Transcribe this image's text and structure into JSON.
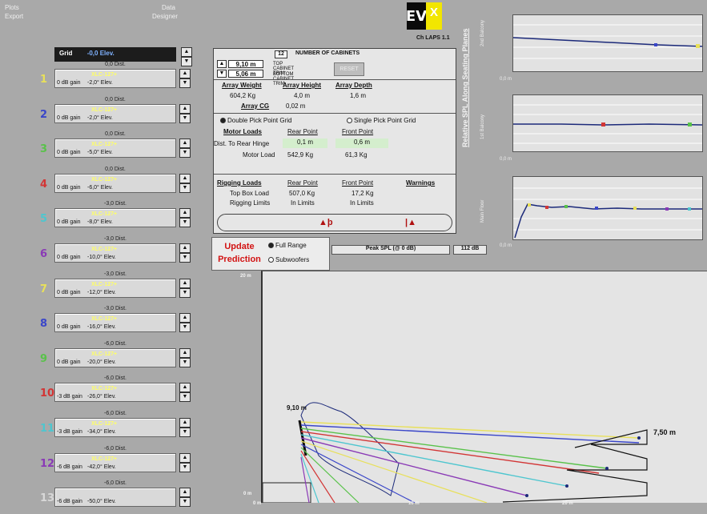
{
  "menu": {
    "left": [
      "Plots",
      "Export"
    ],
    "right": [
      "Data",
      "Designer"
    ]
  },
  "version": "Ch LAPS 1.1",
  "grid_row": {
    "label": "Grid",
    "value": "-0,0 Elev."
  },
  "cabinets": [
    {
      "num": "1",
      "num_color": "#e8e05a",
      "dist": "0,0 Dist.",
      "label": "XLC-127+",
      "gain": "0 dB gain",
      "elev": "-2,0° Elev."
    },
    {
      "num": "2",
      "num_color": "#3a46c9",
      "dist": "0,0 Dist.",
      "label": "XLC-127+",
      "gain": "0 dB gain",
      "elev": "-2,0° Elev."
    },
    {
      "num": "3",
      "num_color": "#59c24a",
      "dist": "0,0 Dist.",
      "label": "XLC-127+",
      "gain": "0 dB gain",
      "elev": "-5,0° Elev."
    },
    {
      "num": "4",
      "num_color": "#d23535",
      "dist": "0,0 Dist.",
      "label": "XLC-127+",
      "gain": "0 dB gain",
      "elev": "-6,0° Elev."
    },
    {
      "num": "5",
      "num_color": "#4ec6cf",
      "dist": "-3,0 Dist.",
      "label": "XLC-127+",
      "gain": "0 dB gain",
      "elev": "-8,0° Elev."
    },
    {
      "num": "6",
      "num_color": "#8a3ab6",
      "dist": "-3,0 Dist.",
      "label": "XLC-127+",
      "gain": "0 dB gain",
      "elev": "-10,0° Elev."
    },
    {
      "num": "7",
      "num_color": "#e8e05a",
      "dist": "-3,0 Dist.",
      "label": "XLC-127+",
      "gain": "0 dB gain",
      "elev": "-12,0° Elev."
    },
    {
      "num": "8",
      "num_color": "#3a46c9",
      "dist": "-3,0 Dist.",
      "label": "XLC-127+",
      "gain": "0 dB gain",
      "elev": "-16,0° Elev."
    },
    {
      "num": "9",
      "num_color": "#59c24a",
      "dist": "-6,0 Dist.",
      "label": "XLC-127+",
      "gain": "0 dB gain",
      "elev": "-20,0° Elev."
    },
    {
      "num": "10",
      "num_color": "#d23535",
      "dist": "-6,0 Dist.",
      "label": "XLC-127+",
      "gain": "-3 dB gain",
      "elev": "-26,0° Elev."
    },
    {
      "num": "11",
      "num_color": "#4ec6cf",
      "dist": "-6,0 Dist.",
      "label": "XLC-127+",
      "gain": "-3 dB gain",
      "elev": "-34,0° Elev."
    },
    {
      "num": "12",
      "num_color": "#8a3ab6",
      "dist": "-6,0 Dist.",
      "label": "XLC-127+",
      "gain": "-6 dB gain",
      "elev": "-42,0° Elev."
    },
    {
      "num": "13",
      "num_color": "#d8d8d8",
      "dist": "-6,0 Dist.",
      "label": "",
      "gain": "-6 dB gain",
      "elev": "-50,0° Elev."
    }
  ],
  "cabinets_count": {
    "value": "12",
    "label": "NUMBER OF CABINETS"
  },
  "trim": {
    "top_value": "9,10 m",
    "top_label": "TOP CABINET TRIM",
    "bottom_value": "5,06 m",
    "bottom_label": "BOTTOM CABINET TRIM",
    "reset": "RESET"
  },
  "array": {
    "weight_h": "Array Weight",
    "height_h": "Array Height",
    "depth_h": "Array Depth",
    "weight": "604,2 Kg",
    "height": "4,0 m",
    "depth": "1,6 m",
    "cg_h": "Array CG",
    "cg": "0,02 m"
  },
  "grid_options": {
    "double": "Double Pick Point Grid",
    "single": "Single Pick Point Grid"
  },
  "motor": {
    "head": "Motor Loads",
    "rear_h": "Rear Point",
    "front_h": "Front Point",
    "dist_label": "Dist. To Rear Hinge",
    "dist_rear": "0,1 m",
    "dist_front": "0,6 m",
    "load_label": "Motor Load",
    "load_rear": "542,9 Kg",
    "load_front": "61,3 Kg"
  },
  "rigging": {
    "head": "Rigging Loads",
    "rear_h": "Rear Point",
    "front_h": "Front Point",
    "warnings_h": "Warnings",
    "top_label": "Top Box Load",
    "top_rear": "507,0 Kg",
    "top_front": "17,2 Kg",
    "limits_label": "Rigging Limits",
    "limits_rear": "In Limits",
    "limits_front": "In Limits"
  },
  "update": {
    "button": "Update Prediction",
    "full": "Full Range",
    "sub": "Subwoofers"
  },
  "peak": {
    "label": "Peak SPL (@ 0 dB)",
    "value": "112 dB"
  },
  "side_title": "Relative SPL Along Seating Planes",
  "plots": [
    {
      "ylabel": "2nd Balcony",
      "xlabel": "0,0 m"
    },
    {
      "ylabel": "1st Balcony",
      "xlabel": "0,0 m"
    },
    {
      "ylabel": "Main Floor",
      "xlabel": "0,0 m"
    }
  ],
  "main_plot": {
    "y_top": "20 m",
    "y_bottom": "0 m",
    "x_ticks": [
      "0 m",
      "10 m",
      "20 m"
    ],
    "top_annotation": "9,10 m",
    "right_annotation": "7,50 m"
  },
  "colors": {
    "yellow": "#e8e05a",
    "blue": "#3a46c9",
    "green": "#59c24a",
    "red": "#d23535",
    "cyan": "#4ec6cf",
    "purple": "#8a3ab6",
    "navy": "#1c2a7a"
  }
}
